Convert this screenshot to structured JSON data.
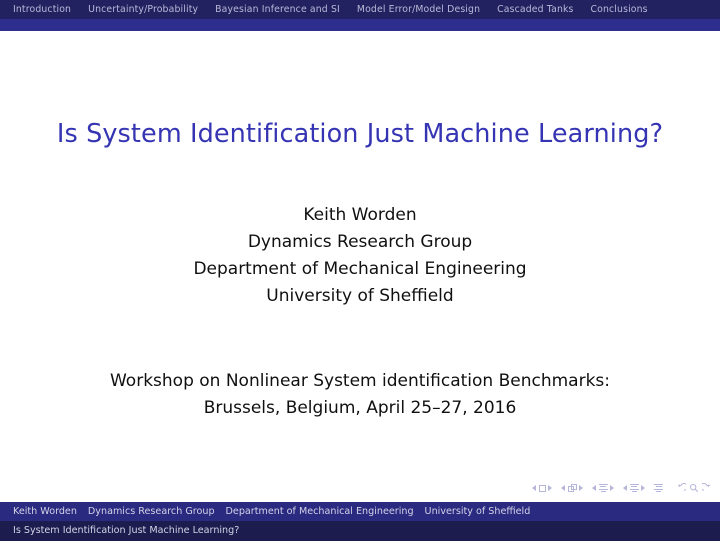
{
  "colors": {
    "nav_bg": "#222261",
    "nav_accent": "#2e2e8f",
    "nav_text": "#b9b9d8",
    "title": "#3535b4",
    "body_bg": "#ffffff",
    "body_text": "#101010",
    "footer_top_bg": "#2a2a81",
    "footer_bottom_bg": "#1c1c4f",
    "footer_text": "#d3d3e6",
    "navsym": "#8a8ac4"
  },
  "navbar": {
    "items": [
      {
        "label": "Introduction"
      },
      {
        "label": "Uncertainty/Probability"
      },
      {
        "label": "Bayesian Inference and SI"
      },
      {
        "label": "Model Error/Model Design"
      },
      {
        "label": "Cascaded Tanks"
      },
      {
        "label": "Conclusions"
      }
    ]
  },
  "slide": {
    "title": "Is System Identification Just Machine Learning?",
    "author_block": [
      "Keith Worden",
      "Dynamics Research Group",
      "Department of Mechanical Engineering",
      "University of Sheffield"
    ],
    "venue_block": [
      "Workshop on Nonlinear System identification Benchmarks:",
      "Brussels, Belgium, April 25–27, 2016"
    ]
  },
  "nav_symbols": {
    "slide_prev": "slide-previous-icon",
    "slide_marker": "slide-icon",
    "slide_next": "slide-next-icon",
    "frame_prev": "frame-previous-icon",
    "frame_marker": "frame-icon",
    "frame_next": "frame-next-icon",
    "subsection_prev": "subsection-previous-icon",
    "subsection_marker": "subsection-icon",
    "subsection_next": "subsection-next-icon",
    "section_prev": "section-previous-icon",
    "section_marker": "section-icon",
    "section_next": "section-next-icon",
    "document_marker": "document-icon",
    "back": "go-back-icon",
    "search": "search-icon",
    "forward": "go-forward-icon"
  },
  "footer": {
    "top_items": [
      "Keith Worden",
      "Dynamics Research Group",
      "Department of Mechanical Engineering",
      "University of Sheffield"
    ],
    "bottom_title": "Is System Identification Just Machine Learning?"
  }
}
